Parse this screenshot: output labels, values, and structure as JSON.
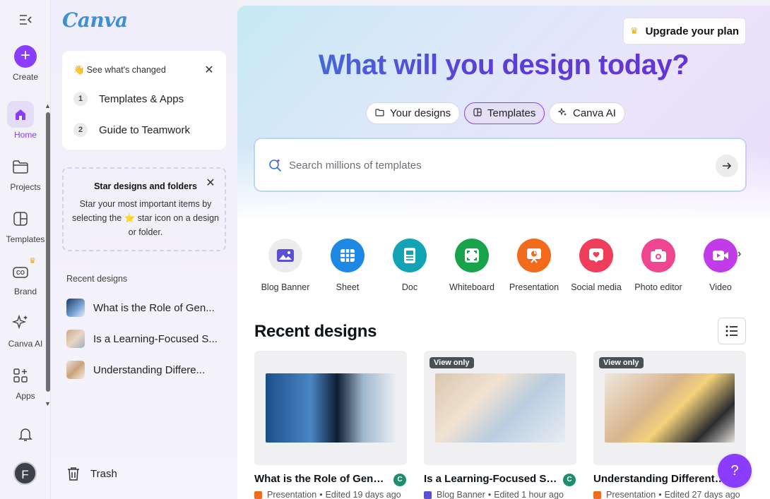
{
  "rail": {
    "create_label": "Create",
    "items": [
      {
        "label": "Home",
        "active": true
      },
      {
        "label": "Projects"
      },
      {
        "label": "Templates"
      },
      {
        "label": "Brand"
      },
      {
        "label": "Canva AI"
      },
      {
        "label": "Apps"
      }
    ],
    "avatar_initial": "F"
  },
  "panel": {
    "logo": "Canva",
    "whats_changed": {
      "title": "See what's changed",
      "steps": [
        {
          "num": "1",
          "label": "Templates & Apps"
        },
        {
          "num": "2",
          "label": "Guide to Teamwork"
        }
      ]
    },
    "star_tip": {
      "title": "Star designs and folders",
      "body": "Star your most important items by selecting the ⭐ star icon on a design or folder."
    },
    "recent_header": "Recent designs",
    "recent": [
      "What is the Role of Gen...",
      "Is a Learning-Focused S...",
      "Understanding Differe..."
    ],
    "trash": "Trash"
  },
  "main": {
    "upgrade": "Upgrade your plan",
    "headline": "What will you design today?",
    "tabs": [
      "Your designs",
      "Templates",
      "Canva AI"
    ],
    "search_placeholder": "Search millions of templates",
    "categories": [
      {
        "label": "Blog Banner",
        "color": "#ececef"
      },
      {
        "label": "Sheet",
        "color": "#1e88e5"
      },
      {
        "label": "Doc",
        "color": "#13a3b4"
      },
      {
        "label": "Whiteboard",
        "color": "#16a34a"
      },
      {
        "label": "Presentation",
        "color": "#f26a1b"
      },
      {
        "label": "Social media",
        "color": "#ef3e5c"
      },
      {
        "label": "Photo editor",
        "color": "#f0468f"
      },
      {
        "label": "Video",
        "color": "#c23be8"
      }
    ],
    "recent_title": "Recent designs",
    "designs": [
      {
        "name": "What is the Role of Gener...",
        "badge": "",
        "type": "Presentation",
        "edited": "Edited 19 days ago",
        "owner": "C"
      },
      {
        "name": "Is a Learning-Focused Su...",
        "badge": "View only",
        "type": "Blog Banner",
        "edited": "Edited 1 hour ago",
        "owner": "C"
      },
      {
        "name": "Understanding Different T...",
        "badge": "View only",
        "type": "Presentation",
        "edited": "Edited 27 days ago",
        "owner": ""
      }
    ],
    "help": "?"
  }
}
